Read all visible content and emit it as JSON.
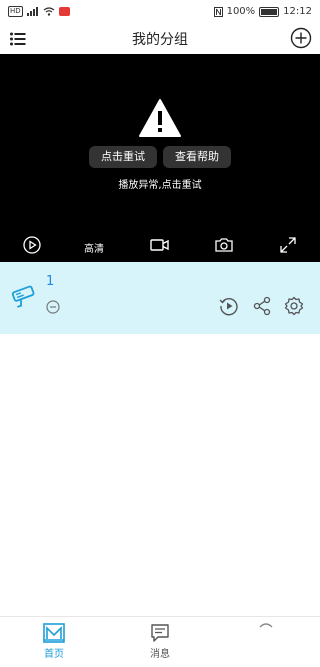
{
  "status_bar": {
    "battery": "100%",
    "time": "12:12"
  },
  "header": {
    "title": "我的分组"
  },
  "player": {
    "retry_label": "点击重试",
    "help_label": "查看帮助",
    "error_text": "播放异常,点击重试",
    "quality_label": "高清"
  },
  "device": {
    "name": "1"
  },
  "tabs": [
    {
      "label": "首页",
      "icon": "home-icon",
      "active": true
    },
    {
      "label": "消息",
      "icon": "message-icon",
      "active": false
    }
  ],
  "colors": {
    "accent": "#1e9fd8",
    "card_bg": "#d7f4fb",
    "player_bg": "#000000"
  }
}
